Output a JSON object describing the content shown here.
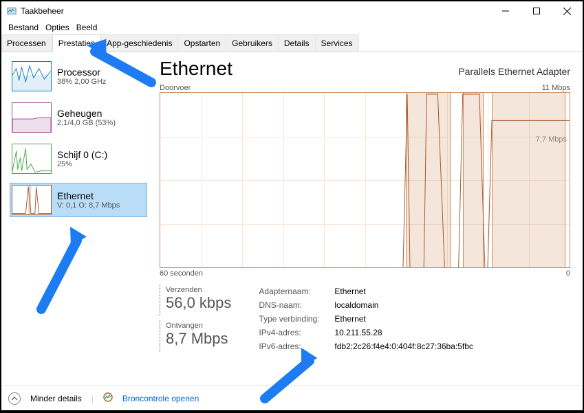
{
  "window": {
    "title": "Taakbeheer"
  },
  "menubar": [
    "Bestand",
    "Opties",
    "Beeld"
  ],
  "tabs": [
    {
      "label": "Processen"
    },
    {
      "label": "Prestaties",
      "active": true
    },
    {
      "label": "App-geschiedenis"
    },
    {
      "label": "Opstarten"
    },
    {
      "label": "Gebruikers"
    },
    {
      "label": "Details"
    },
    {
      "label": "Services"
    }
  ],
  "sidebar": [
    {
      "title": "Processor",
      "sub": "38%  2,00 GHz",
      "type": "cpu"
    },
    {
      "title": "Geheugen",
      "sub": "2,1/4,0 GB (53%)",
      "type": "mem"
    },
    {
      "title": "Schijf 0 (C:)",
      "sub": "25%",
      "type": "disk"
    },
    {
      "title": "Ethernet",
      "sub": "V: 0,1  O: 8,7 Mbps",
      "type": "net",
      "selected": true
    }
  ],
  "main": {
    "heading": "Ethernet",
    "adapter": "Parallels Ethernet Adapter",
    "chart_top_left": "Doorvoer",
    "chart_top_right": "11 Mbps",
    "chart_inner_label": "7,7 Mbps",
    "x_left": "60 seconden",
    "x_right": "0",
    "send_label": "Verzenden",
    "send_value": "56,0 kbps",
    "recv_label": "Ontvangen",
    "recv_value": "8,7 Mbps",
    "details": [
      {
        "k": "Adapternaam:",
        "v": "Ethernet"
      },
      {
        "k": "DNS-naam:",
        "v": "localdomain"
      },
      {
        "k": "Type verbinding:",
        "v": "Ethernet"
      },
      {
        "k": "IPv4-adres:",
        "v": "10.211.55.28"
      },
      {
        "k": "IPv6-adres:",
        "v": "fdb2:2c26:f4e4:0:404f:8c27:36ba:5fbc"
      }
    ]
  },
  "footer": {
    "less": "Minder details",
    "resmon": "Broncontrole openen"
  }
}
